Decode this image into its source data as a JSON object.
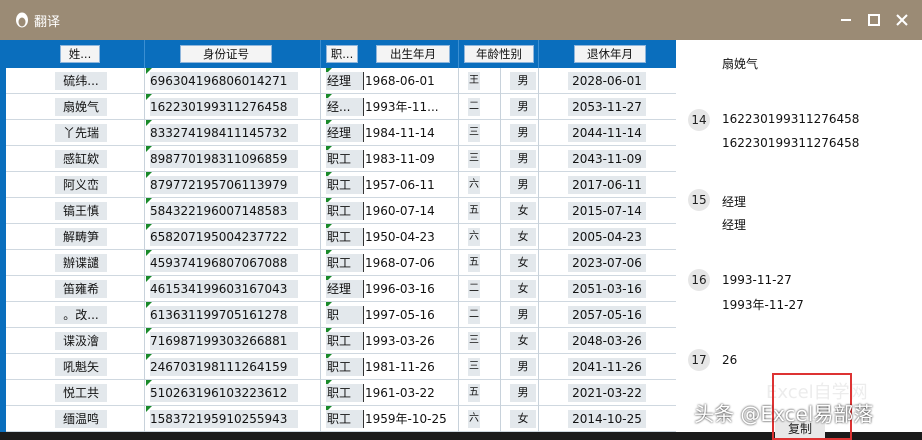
{
  "window": {
    "title": "翻译",
    "buttons": [
      "minimize",
      "maximize",
      "close"
    ]
  },
  "sheet": {
    "headers": [
      "姓...",
      "身份证号",
      "职...",
      "出生年月",
      "年龄性别",
      "退休年月"
    ],
    "rows": [
      {
        "name": "硫纬...",
        "id": "696304196806014271",
        "job": "经理",
        "birth": "1968-06-01",
        "age": "王",
        "sex": "男",
        "retire": "2028-06-01"
      },
      {
        "name": "扇娩气",
        "id": "162230199311276458",
        "job": "经...",
        "birth": "1993年-11...",
        "age": "二",
        "sex": "男",
        "retire": "2053-11-27"
      },
      {
        "name": "丫先瑞",
        "id": "833274198411145732",
        "job": "经理",
        "birth": "1984-11-14",
        "age": "三",
        "sex": "男",
        "retire": "2044-11-14"
      },
      {
        "name": "感缸欸",
        "id": "898770198311096859",
        "job": "职工",
        "birth": "1983-11-09",
        "age": "三",
        "sex": "男",
        "retire": "2043-11-09"
      },
      {
        "name": "阿义峦",
        "id": "879772195706113979",
        "job": "职工",
        "birth": "1957-06-11",
        "age": "六",
        "sex": "男",
        "retire": "2017-06-11"
      },
      {
        "name": "镐王慎",
        "id": "584322196007148583",
        "job": "职工",
        "birth": "1960-07-14",
        "age": "五",
        "sex": "女",
        "retire": "2015-07-14"
      },
      {
        "name": "解畴笋",
        "id": "658207195004237722",
        "job": "职工",
        "birth": "1950-04-23",
        "age": "六",
        "sex": "女",
        "retire": "2005-04-23"
      },
      {
        "name": "辦谍譴",
        "id": "459374196807067088",
        "job": "职工",
        "birth": "1968-07-06",
        "age": "五",
        "sex": "女",
        "retire": "2023-07-06"
      },
      {
        "name": "笛雍希",
        "id": "461534199603167043",
        "job": "经理",
        "birth": "1996-03-16",
        "age": "二",
        "sex": "女",
        "retire": "2051-03-16"
      },
      {
        "name": "。改...",
        "id": "613631199705161278",
        "job": "职",
        "birth": "1997-05-16",
        "age": "二",
        "sex": "男",
        "retire": "2057-05-16"
      },
      {
        "name": "谍汲澮",
        "id": "716987199303266881",
        "job": "职工",
        "birth": "1993-03-26",
        "age": "三",
        "sex": "女",
        "retire": "2048-03-26"
      },
      {
        "name": "吼魁矢",
        "id": "246703198111264159",
        "job": "职工",
        "birth": "1981-11-26",
        "age": "三",
        "sex": "男",
        "retire": "2041-11-26"
      },
      {
        "name": "悦工共",
        "id": "510263196103223612",
        "job": "职工",
        "birth": "1961-03-22",
        "age": "五",
        "sex": "男",
        "retire": "2021-03-22"
      },
      {
        "name": "缅温鸣",
        "id": "158372195910255943",
        "job": "职工",
        "birth": "1959年-10-25",
        "age": "六",
        "sex": "女",
        "retire": "2014-10-25"
      }
    ]
  },
  "translation": {
    "top_text": "扇娩气",
    "entries": [
      {
        "num": "14",
        "line1": "162230199311276458",
        "line2": "162230199311276458"
      },
      {
        "num": "15",
        "line1": "经理",
        "line2": "经理"
      },
      {
        "num": "16",
        "line1": "1993-11-27",
        "line2": "1993年-11-27"
      },
      {
        "num": "17",
        "line1": "26",
        "line2": ""
      }
    ],
    "copy_label": "复制"
  },
  "watermark": {
    "main": "头条 @Excel易部落",
    "sub": "Excel自学网"
  },
  "colors": {
    "titlebar": "#9b8b75",
    "header_blue": "#0a6ebd",
    "highlight_red": "#dd3333"
  }
}
